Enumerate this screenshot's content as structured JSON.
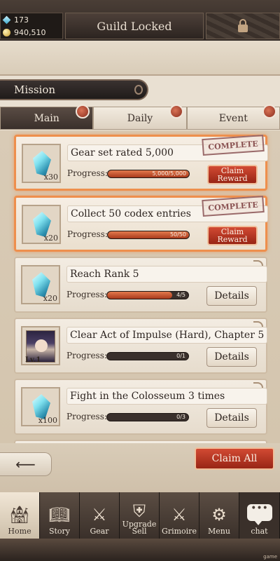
{
  "currencies": {
    "gems": "173",
    "gold": "940,510"
  },
  "guild": {
    "label": "Guild Locked"
  },
  "header": {
    "title": "Mission"
  },
  "tabs": [
    {
      "label": "Main",
      "active": true
    },
    {
      "label": "Daily",
      "active": false
    },
    {
      "label": "Event",
      "active": false
    }
  ],
  "progress_label": "Progress:",
  "missions": [
    {
      "title": "Gear set rated 5,000",
      "reward_qty": "x30",
      "progress_text": "5,000/5,000",
      "progress": 1.0,
      "status": "COMPLETE",
      "button": "Claim\nReward"
    },
    {
      "title": "Collect 50 codex entries",
      "reward_qty": "x20",
      "progress_text": "50/50",
      "progress": 1.0,
      "status": "COMPLETE",
      "button": "Claim\nReward"
    },
    {
      "title": "Reach Rank 5",
      "reward_qty": "x20",
      "progress_text": "4/5",
      "progress": 0.8,
      "button": "Details"
    },
    {
      "title": "Clear Act of Impulse (Hard), Chapter 5",
      "reward_level": "Lv.1",
      "progress_text": "0/1",
      "progress": 0.0,
      "button": "Details"
    },
    {
      "title": "Fight in the Colosseum 3 times",
      "reward_qty": "x100",
      "progress_text": "0/3",
      "progress": 0.0,
      "button": "Details"
    }
  ],
  "claim_all": "Claim All",
  "nav": [
    {
      "label": "Home",
      "icon": "castle-icon"
    },
    {
      "label": "Story",
      "icon": "book-icon"
    },
    {
      "label": "Gear",
      "icon": "armor-icon"
    },
    {
      "label": "Upgrade\nSell",
      "icon": "shield-upgrade-icon"
    },
    {
      "label": "Grimoire",
      "icon": "crossed-swords-icon"
    },
    {
      "label": "Menu",
      "icon": "gears-icon"
    },
    {
      "label": "chat",
      "icon": "chat-bubble-icon"
    }
  ],
  "footer_tag": "game",
  "colors": {
    "accent_red": "#b8321d",
    "complete_border": "#ee8f4d",
    "dark_brown": "#3a302a"
  }
}
